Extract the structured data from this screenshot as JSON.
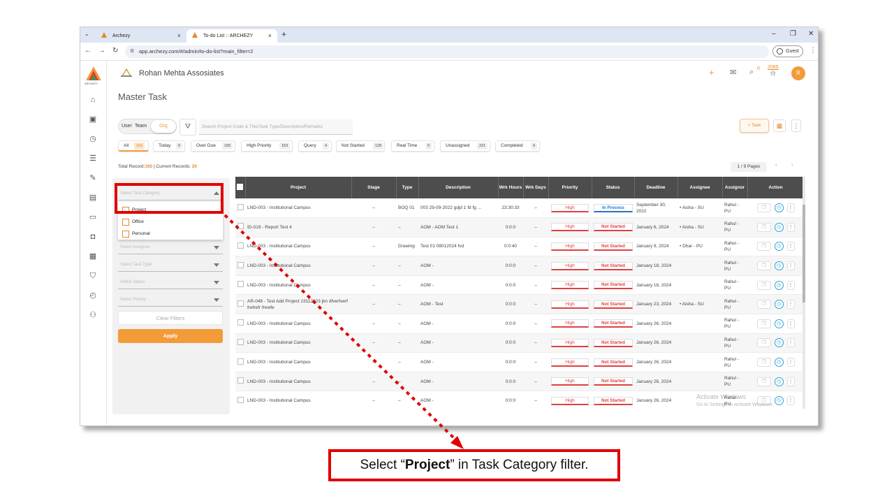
{
  "browser": {
    "tabs": [
      {
        "title": "Archezy",
        "active": false
      },
      {
        "title": "To-do List :: ARCHEZY",
        "active": true
      }
    ],
    "url": "app.archezy.com/#/admin/to-do-list?main_filter=2",
    "profile": "Guest"
  },
  "app": {
    "logo_text": "ARCHEZY",
    "org_name": "Rohan Mehta Assosiates",
    "page_title": "Master Task",
    "header": {
      "chat_count": "0",
      "notif_count": "2065",
      "avatar_letter": "R"
    },
    "brand_color": "#f29b38"
  },
  "toolbar": {
    "scope": {
      "user": "User",
      "team": "Team",
      "org": "Org"
    },
    "search_placeholder": "Search Project Code & Title/Task Type/Description/Remarks",
    "task_button": "Task"
  },
  "filter_chips": [
    {
      "label": "All",
      "count": "165",
      "active": true
    },
    {
      "label": "Today",
      "count": "0"
    },
    {
      "label": "Over Due",
      "count": "165"
    },
    {
      "label": "High Priority",
      "count": "153"
    },
    {
      "label": "Query",
      "count": "4"
    },
    {
      "label": "Not Started",
      "count": "128"
    },
    {
      "label": "Real Time",
      "count": "0"
    },
    {
      "label": "Unassigned",
      "count": "221"
    },
    {
      "label": "Completed",
      "count": "9"
    }
  ],
  "records": {
    "prefix": "Total Record:",
    "total": "165",
    "mid": " | Current Records: ",
    "current": "20"
  },
  "pagination": "1 / 9 Pages",
  "filters": {
    "task_category_placeholder": "Select Task Category",
    "options": [
      "Project",
      "Office",
      "Personal"
    ],
    "assignee_placeholder": "Select Assignee",
    "task_type_placeholder": "Select Task Type",
    "status_placeholder": "Select Status",
    "priority_placeholder": "Select Priority",
    "clear": "Clear Filters",
    "apply": "Apply"
  },
  "table": {
    "columns": [
      "Project",
      "Stage",
      "Type",
      "Description",
      "Wrk Hours",
      "Wrk Days",
      "Priority",
      "Status",
      "Deadline",
      "Assignee",
      "Assignor",
      "Action"
    ],
    "rows": [
      {
        "project": "LND-003 - Institutional Campus",
        "stage": "–",
        "type": "BOQ 01",
        "desc": "003 29-09-2022 gdjd 1 fd fg ...",
        "hours": "23:30:33",
        "days": "–",
        "priority": "High",
        "status": "In Process",
        "deadline": "September 30, 2022",
        "assignee": "Aisha - SU",
        "assignor": "Rahul - PU"
      },
      {
        "project": "ID-019 - Report Test 4",
        "stage": "–",
        "type": "–",
        "desc": "AOM - AOM Test 1",
        "hours": "0:0:0",
        "days": "–",
        "priority": "High",
        "status": "Not Started",
        "deadline": "January 6, 2024",
        "assignee": "Aisha - SU",
        "assignor": "Rahul - PU"
      },
      {
        "project": "LND-003 - Institutional Campus",
        "stage": "–",
        "type": "Drawing",
        "desc": "Test 01 08012024 fvd",
        "hours": "0:0:40",
        "days": "–",
        "priority": "High",
        "status": "Not Started",
        "deadline": "January 9, 2024",
        "assignee": "Dhar - PU",
        "assignor": "Rahul - PU"
      },
      {
        "project": "LND-003 - Institutional Campus",
        "stage": "–",
        "type": "–",
        "desc": "AOM -",
        "hours": "0:0:0",
        "days": "–",
        "priority": "High",
        "status": "Not Started",
        "deadline": "January 18, 2024",
        "assignee": "",
        "assignor": "Rahul - PU"
      },
      {
        "project": "LND-003 - Institutional Campus",
        "stage": "–",
        "type": "–",
        "desc": "AOM -",
        "hours": "0:0:0",
        "days": "–",
        "priority": "High",
        "status": "Not Started",
        "deadline": "January 18, 2024",
        "assignee": "",
        "assignor": "Rahul - PU"
      },
      {
        "project": "AR-048 - Test Add Project 23112023 jkn dfverfverf frefrefr frewfe",
        "stage": "–",
        "type": "–",
        "desc": "AOM - Test",
        "hours": "0:0:0",
        "days": "–",
        "priority": "High",
        "status": "Not Started",
        "deadline": "January 23, 2024",
        "assignee": "Aisha - SU",
        "assignor": "Rahul - PU"
      },
      {
        "project": "LND-003 - Institutional Campus",
        "stage": "–",
        "type": "–",
        "desc": "AOM -",
        "hours": "0:0:0",
        "days": "–",
        "priority": "High",
        "status": "Not Started",
        "deadline": "January 26, 2024",
        "assignee": "",
        "assignor": "Rahul - PU"
      },
      {
        "project": "LND-003 - Institutional Campus",
        "stage": "–",
        "type": "–",
        "desc": "AOM -",
        "hours": "0:0:0",
        "days": "–",
        "priority": "High",
        "status": "Not Started",
        "deadline": "January 26, 2024",
        "assignee": "",
        "assignor": "Rahul - PU"
      },
      {
        "project": "LND-003 - Institutional Campus",
        "stage": "–",
        "type": "–",
        "desc": "AOM -",
        "hours": "0:0:0",
        "days": "–",
        "priority": "High",
        "status": "Not Started",
        "deadline": "January 26, 2024",
        "assignee": "",
        "assignor": "Rahul - PU"
      },
      {
        "project": "LND-003 - Institutional Campus",
        "stage": "–",
        "type": "–",
        "desc": "AOM -",
        "hours": "0:0:0",
        "days": "–",
        "priority": "High",
        "status": "Not Started",
        "deadline": "January 26, 2024",
        "assignee": "",
        "assignor": "Rahul - PU"
      },
      {
        "project": "LND-003 - Institutional Campus",
        "stage": "–",
        "type": "–",
        "desc": "AOM -",
        "hours": "0:0:0",
        "days": "–",
        "priority": "High",
        "status": "Not Started",
        "deadline": "January 26, 2024",
        "assignee": "",
        "assignor": "Rahul - PU"
      }
    ]
  },
  "watermark": {
    "line1": "Activate Windows",
    "line2": "Go to Settings to activate Windows."
  },
  "instruction": {
    "pre": "Select “",
    "bold": "Project",
    "post": "” in Task Category filter."
  }
}
